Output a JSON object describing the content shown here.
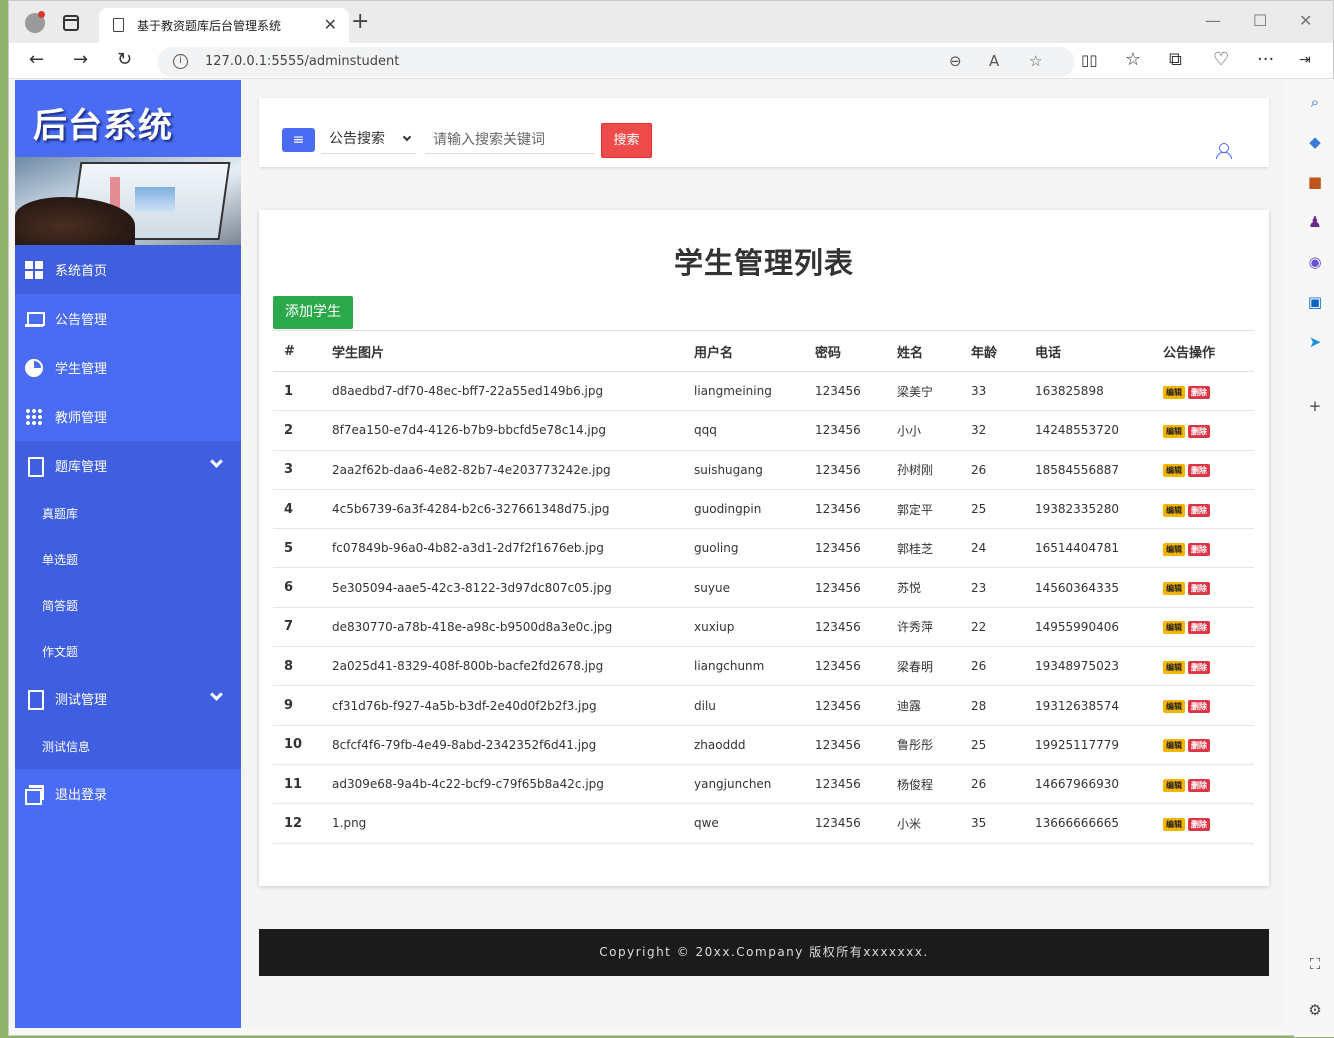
{
  "browser": {
    "tab_title": "基于教资题库后台管理系统",
    "tab_close": "✕",
    "new_tab": "+",
    "url": "127.0.0.1:5555/adminstudent",
    "win_min": "—",
    "win_max": "☐",
    "win_close": "✕"
  },
  "sidebar": {
    "logo": "后台系统",
    "items": [
      {
        "label": "系统首页",
        "icon": "grid-icon"
      },
      {
        "label": "公告管理",
        "icon": "laptop-icon"
      },
      {
        "label": "学生管理",
        "icon": "pie-chart-icon"
      },
      {
        "label": "教师管理",
        "icon": "dots-grid-icon"
      },
      {
        "label": "题库管理",
        "icon": "document-icon"
      },
      {
        "label": "测试管理",
        "icon": "document-icon"
      },
      {
        "label": "退出登录",
        "icon": "window-icon"
      }
    ],
    "question_bank_sub": [
      "真题库",
      "单选题",
      "简答题",
      "作文题"
    ],
    "test_sub": [
      "测试信息"
    ]
  },
  "header": {
    "menu_icon": "≡",
    "select_value": "公告搜索",
    "search_placeholder": "请输入搜索关键词",
    "search_button": "搜索"
  },
  "main": {
    "title": "学生管理列表",
    "add_button": "添加学生",
    "columns": [
      "#",
      "学生图片",
      "用户名",
      "密码",
      "姓名",
      "年龄",
      "电话",
      "公告操作"
    ],
    "edit_label": "编辑",
    "delete_label": "删除",
    "rows": [
      [
        "1",
        "d8aedbd7-df70-48ec-bff7-22a55ed149b6.jpg",
        "liangmeining",
        "123456",
        "梁美宁",
        "33",
        "163825898"
      ],
      [
        "2",
        "8f7ea150-e7d4-4126-b7b9-bbcfd5e78c14.jpg",
        "qqq",
        "123456",
        "小小",
        "32",
        "14248553720"
      ],
      [
        "3",
        "2aa2f62b-daa6-4e82-82b7-4e203773242e.jpg",
        "suishugang",
        "123456",
        "孙树刚",
        "26",
        "18584556887"
      ],
      [
        "4",
        "4c5b6739-6a3f-4284-b2c6-327661348d75.jpg",
        "guodingpin",
        "123456",
        "郭定平",
        "25",
        "19382335280"
      ],
      [
        "5",
        "fc07849b-96a0-4b82-a3d1-2d7f2f1676eb.jpg",
        "guoling",
        "123456",
        "郭桂芝",
        "24",
        "16514404781"
      ],
      [
        "6",
        "5e305094-aae5-42c3-8122-3d97dc807c05.jpg",
        "suyue",
        "123456",
        "苏悦",
        "23",
        "14560364335"
      ],
      [
        "7",
        "de830770-a78b-418e-a98c-b9500d8a3e0c.jpg",
        "xuxiup",
        "123456",
        "许秀萍",
        "22",
        "14955990406"
      ],
      [
        "8",
        "2a025d41-8329-408f-800b-bacfe2fd2678.jpg",
        "liangchunm",
        "123456",
        "梁春明",
        "26",
        "19348975023"
      ],
      [
        "9",
        "cf31d76b-f927-4a5b-b3df-2e40d0f2b2f3.jpg",
        "dilu",
        "123456",
        "迪露",
        "28",
        "19312638574"
      ],
      [
        "10",
        "8cfcf4f6-79fb-4e49-8abd-2342352f6d41.jpg",
        "zhaoddd",
        "123456",
        "鲁彤彤",
        "25",
        "19925117779"
      ],
      [
        "11",
        "ad309e68-9a4b-4c22-bcf9-c79f65b8a42c.jpg",
        "yangjunchen",
        "123456",
        "杨俊程",
        "26",
        "14667966930"
      ],
      [
        "12",
        "1.png",
        "qwe",
        "123456",
        "小米",
        "35",
        "13666666665"
      ]
    ]
  },
  "footer": {
    "text": "Copyright © 20xx.Company 版权所有xxxxxxx."
  }
}
